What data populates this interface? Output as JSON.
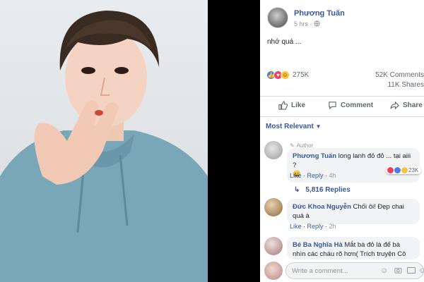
{
  "post": {
    "author": "Phương Tuấn",
    "time": "5 hrs",
    "privacy_separator": "·",
    "text": "nhớ quá ..."
  },
  "stats": {
    "reactions": "275K",
    "comments": "52K Comments",
    "shares": "11K Shares"
  },
  "actions": {
    "like": "Like",
    "comment": "Comment",
    "share": "Share"
  },
  "sort_label": "Most Relevant",
  "comments": [
    {
      "author_tag": "Author",
      "name": "Phương Tuấn",
      "text": "long lanh đỏ đỏ ... tại aiii ?",
      "emoji": "😄",
      "like": "Like",
      "reply": "Reply",
      "time": "4h",
      "reactions": "23K",
      "replies_label": "5,816 Replies"
    },
    {
      "name": "Đức Khoa Nguyễn",
      "text": "Chối ôi! Đẹp chai quá à",
      "like": "Like",
      "reply": "Reply",
      "time": "2h"
    },
    {
      "name": "Bé Ba Nghĩa Hà",
      "text": "Mắt bà đỏ là để bà nhìn các cháu rõ hơn( Trích truyện Cô Bé"
    }
  ],
  "composer": {
    "placeholder": "Write a comment..."
  },
  "icons": [
    "globe-icon",
    "thumbs-up-icon",
    "comment-icon",
    "share-icon",
    "pencil-icon",
    "reply-arrow-icon",
    "emoji-icon",
    "camera-icon",
    "gif-icon",
    "sticker-icon"
  ],
  "colors": {
    "link": "#385898",
    "secondary_text": "#606770",
    "like_blue": "#4c7bea",
    "love_red": "#f0405a",
    "haha_yellow": "#f7c23b"
  }
}
